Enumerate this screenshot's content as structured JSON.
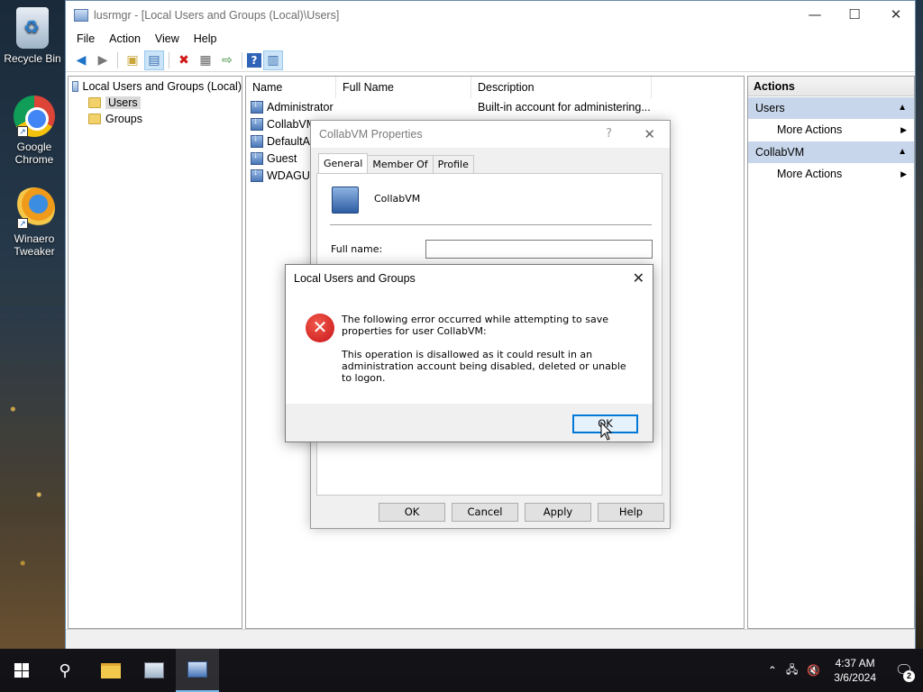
{
  "desktop": {
    "icons": [
      {
        "label": "Recycle Bin"
      },
      {
        "label": "Google Chrome"
      },
      {
        "label": "Winaero Tweaker"
      }
    ]
  },
  "window": {
    "title": "lusrmgr - [Local Users and Groups (Local)\\Users]",
    "controls": {
      "minimize": "—",
      "maximize": "☐",
      "close": "✕"
    },
    "menu": [
      "File",
      "Action",
      "View",
      "Help"
    ],
    "toolbar_icons": [
      "back-icon",
      "forward-icon",
      "up-folder-icon",
      "show-hide-tree-icon",
      "delete-icon",
      "properties-icon",
      "export-icon",
      "help-icon",
      "show-hide-action-pane-icon"
    ]
  },
  "tree": {
    "root": "Local Users and Groups (Local)",
    "children": [
      "Users",
      "Groups"
    ],
    "selected": "Users"
  },
  "list": {
    "columns": [
      "Name",
      "Full Name",
      "Description"
    ],
    "rows": [
      {
        "name": "Administrator",
        "full_name": "",
        "description": "Built-in account for administering..."
      },
      {
        "name": "CollabVM",
        "full_name": "",
        "description": ""
      },
      {
        "name": "DefaultAc",
        "full_name": "",
        "description": ""
      },
      {
        "name": "Guest",
        "full_name": "",
        "description": ""
      },
      {
        "name": "WDAGUti",
        "full_name": "",
        "description": ""
      }
    ]
  },
  "actions_pane": {
    "title": "Actions",
    "sections": [
      {
        "header": "Users",
        "items": [
          "More Actions"
        ]
      },
      {
        "header": "CollabVM",
        "items": [
          "More Actions"
        ]
      }
    ]
  },
  "properties_dialog": {
    "title": "CollabVM Properties",
    "help": "?",
    "close": "✕",
    "tabs": [
      "General",
      "Member Of",
      "Profile"
    ],
    "active_tab": "General",
    "user_name": "CollabVM",
    "full_name_label": "Full name:",
    "full_name_value": "",
    "buttons": {
      "ok": "OK",
      "cancel": "Cancel",
      "apply": "Apply",
      "help": "Help"
    }
  },
  "error_dialog": {
    "title": "Local Users and Groups",
    "close": "✕",
    "message_1": "The following error occurred while attempting to save properties for user CollabVM:",
    "message_2": "This operation is disallowed as it could result in an administration account being disabled, deleted or unable to logon.",
    "ok_label": "OK"
  },
  "taskbar": {
    "time": "4:37 AM",
    "date": "3/6/2024",
    "notification_count": "2"
  }
}
